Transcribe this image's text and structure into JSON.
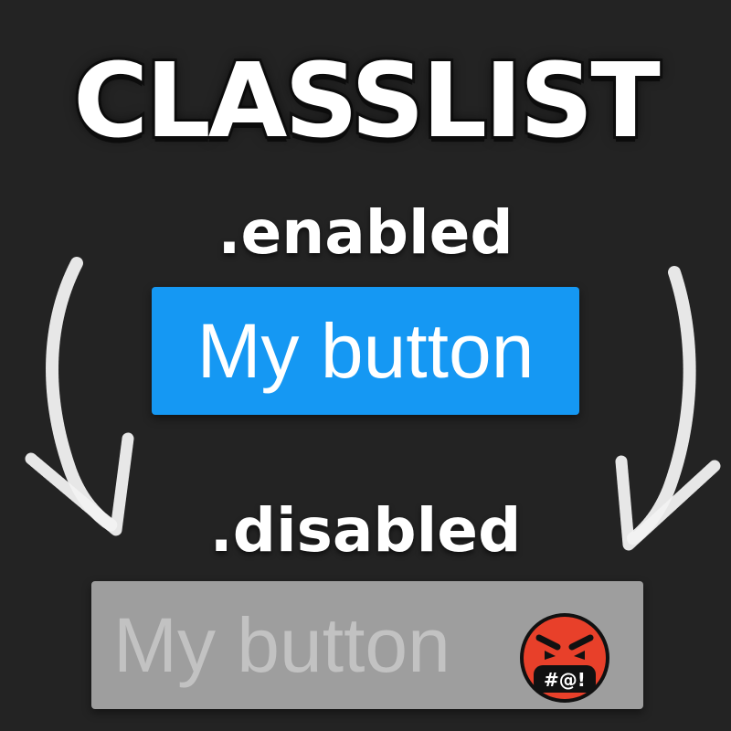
{
  "title": "CLASSLIST",
  "states": {
    "enabled": {
      "class_label": ".enabled",
      "button_label": "My button"
    },
    "disabled": {
      "class_label": ".disabled",
      "button_label": "My button",
      "emoji_icon": "angry-face-with-symbols-icon",
      "emoji_text": "#@!"
    }
  },
  "colors": {
    "background": "#232323",
    "enabled_button": "#1598f3",
    "disabled_button": "#9e9e9e",
    "disabled_text": "#c2c2c2",
    "emoji_red": "#e8402a"
  }
}
